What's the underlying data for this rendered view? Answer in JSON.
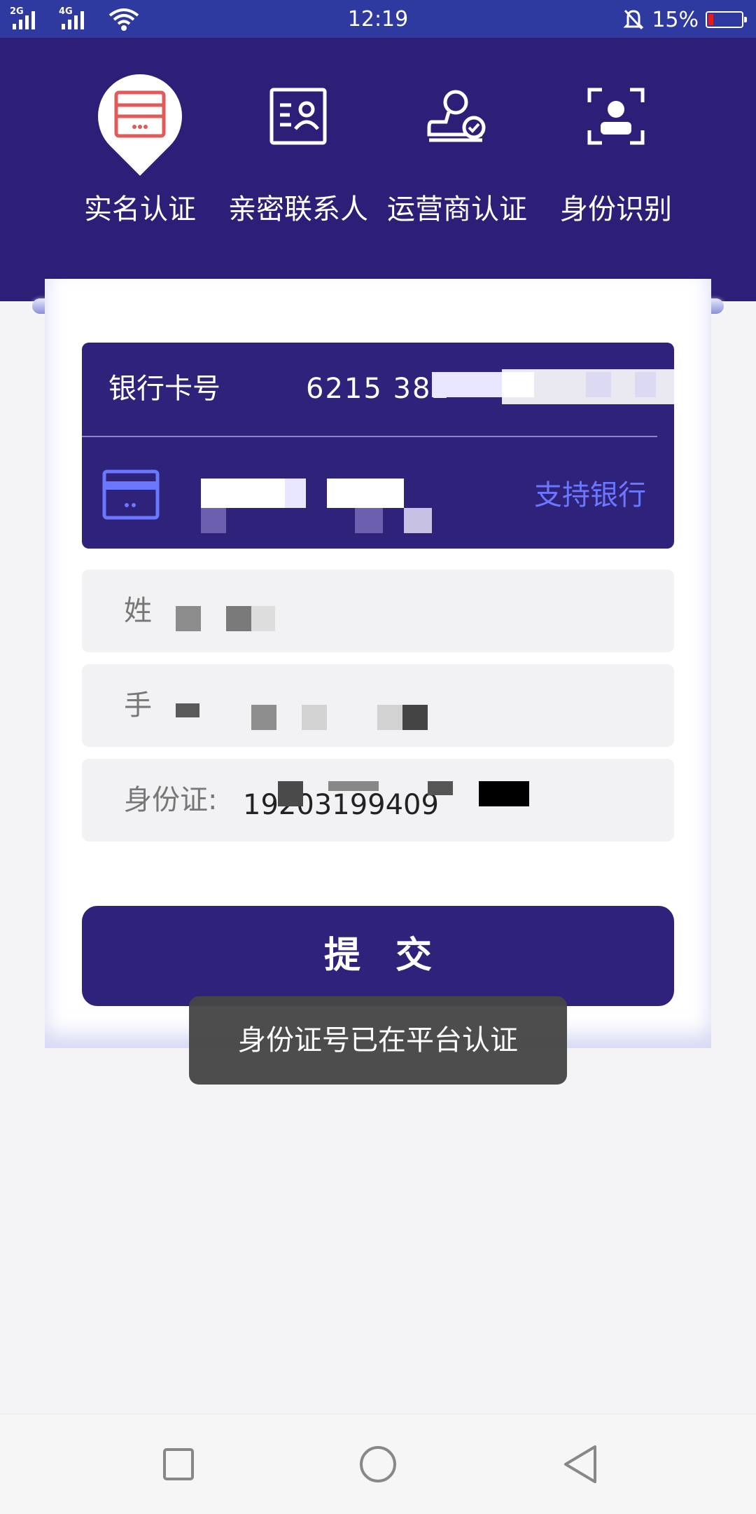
{
  "status_bar": {
    "net1": "2G",
    "net2": "4G",
    "time": "12:19",
    "battery_text": "15%",
    "battery_level": 0.15
  },
  "steps": [
    {
      "label": "实名认证",
      "icon": "id-card-icon",
      "active": true
    },
    {
      "label": "亲密联系人",
      "icon": "contact-card-icon",
      "active": false
    },
    {
      "label": "运营商认证",
      "icon": "carrier-stamp-icon",
      "active": false
    },
    {
      "label": "身份识别",
      "icon": "face-scan-icon",
      "active": false
    }
  ],
  "bank_card": {
    "label": "银行卡号",
    "number_visible": "6215  382",
    "support_link": "支持银行"
  },
  "fields": {
    "name_label": "姓",
    "phone_label": "手",
    "idcard_label": "身份证:",
    "idcard_value": "  19203199409"
  },
  "submit_label": "提交",
  "toast": "身份证号已在平台认证",
  "colors": {
    "header": "#2d1f78",
    "status_bar": "#2e3aa0",
    "primary": "#2f227a",
    "accent_red": "#e05a5a"
  }
}
